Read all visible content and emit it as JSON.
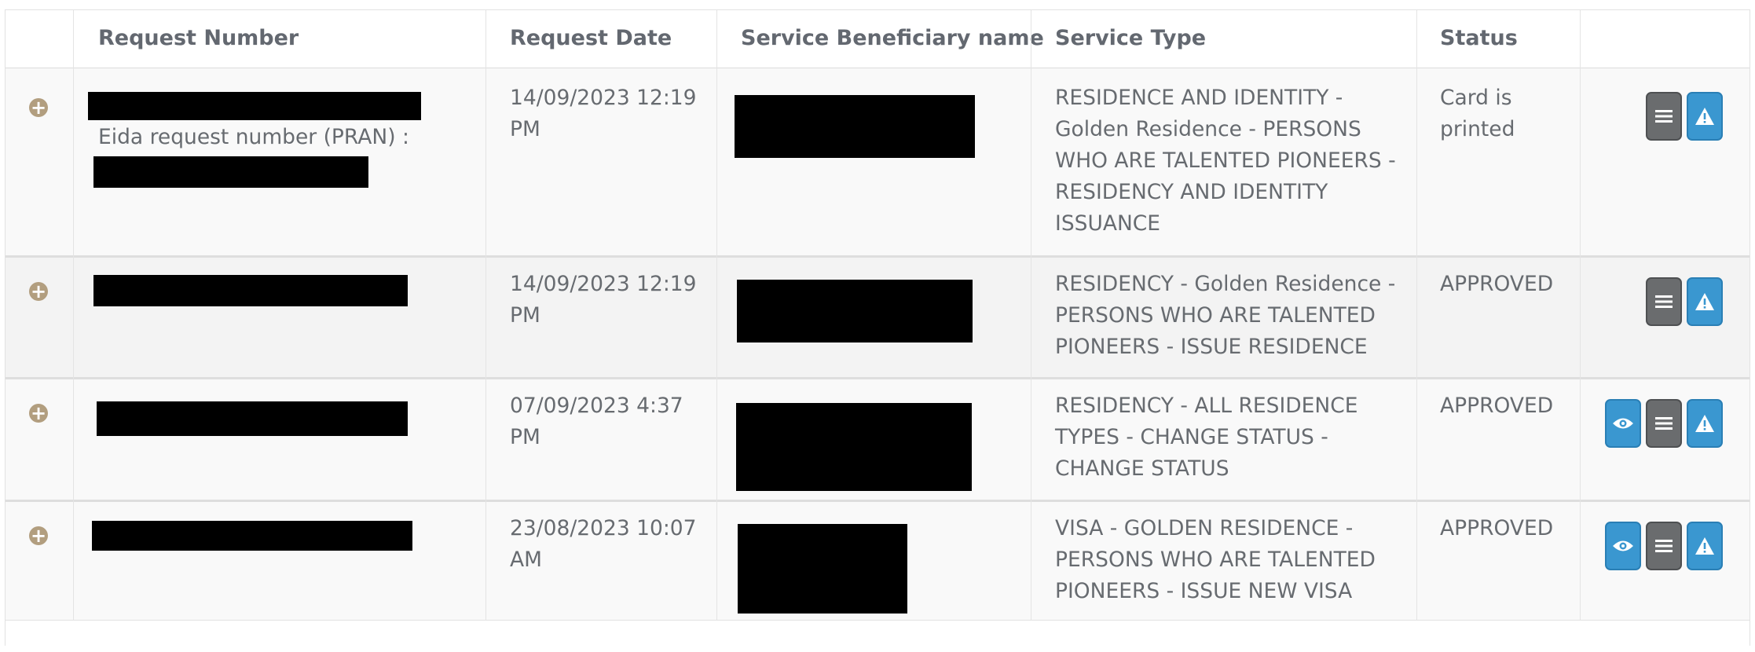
{
  "table": {
    "headers": {
      "request_number": "Request Number",
      "request_date": "Request Date",
      "beneficiary": "Service Beneficiary name",
      "service_type": "Service Type",
      "status": "Status"
    },
    "rows": [
      {
        "request_number_extra": "Eida request number (PRAN) :",
        "date_line1": "14/09/2023 12:19",
        "date_line2": "PM",
        "service_type_lines": [
          "RESIDENCE AND IDENTITY -",
          "Golden Residence - PERSONS",
          "WHO ARE TALENTED PIONEERS -",
          "RESIDENCY AND IDENTITY",
          "ISSUANCE"
        ],
        "status_lines": [
          "Card is",
          "printed"
        ]
      },
      {
        "date_line1": "14/09/2023 12:19",
        "date_line2": "PM",
        "service_type_lines": [
          "RESIDENCY - Golden Residence -",
          "PERSONS WHO ARE TALENTED",
          "PIONEERS - ISSUE RESIDENCE"
        ],
        "status_lines": [
          "APPROVED"
        ]
      },
      {
        "date_line1": "07/09/2023 4:37",
        "date_line2": "PM",
        "service_type_lines": [
          "RESIDENCY - ALL RESIDENCE",
          "TYPES - CHANGE STATUS -",
          "CHANGE STATUS"
        ],
        "status_lines": [
          "APPROVED"
        ]
      },
      {
        "date_line1": "23/08/2023 10:07",
        "date_line2": "AM",
        "service_type_lines": [
          "VISA - GOLDEN RESIDENCE -",
          "PERSONS WHO ARE TALENTED",
          "PIONEERS - ISSUE NEW VISA"
        ],
        "status_lines": [
          "APPROVED"
        ]
      }
    ]
  },
  "icons": {
    "expand": "plus-circle-icon",
    "view": "eye-icon",
    "details": "list-icon",
    "report": "warning-icon"
  },
  "colors": {
    "expand_icon": "#b29e7f",
    "button_grey": "#6a6c6e",
    "button_blue": "#3a97d0",
    "text": "#676b70",
    "row_odd": "#f9f9f9",
    "row_even": "#f3f3f3"
  }
}
